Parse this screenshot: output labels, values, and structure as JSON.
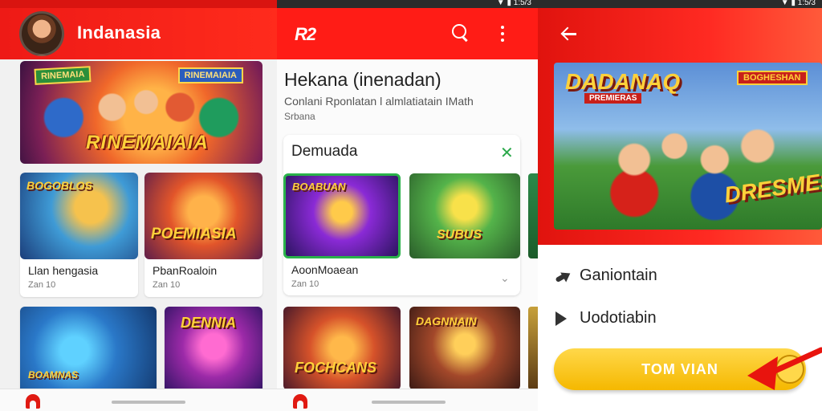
{
  "panel1": {
    "app_name": "Indanasia",
    "hero": {
      "title": "RINEMAIAIA",
      "tag_left": "RINEMAIA",
      "tag_right": "RINEMAIAIA"
    },
    "cards": [
      {
        "thumb_label": "BOGOBLOS",
        "title": "Llan hengasia",
        "sub": "Zan 10"
      },
      {
        "thumb_label": "POEMIASIA",
        "title": "PbanRoaloin",
        "sub": "Zan 10"
      }
    ],
    "tiles": [
      {
        "label": "BOAMNAS"
      },
      {
        "label": "DENNIA"
      }
    ],
    "nav_icon": "home-icon"
  },
  "panel2": {
    "status_text": "▼ ▮ 1:5/3",
    "logo": "R2",
    "heading": "Hekana (inenadan)",
    "sub1": "Conlani Rponlatan l almlatiatain IMath",
    "sub2": "Srbana",
    "section_title": "Demuada",
    "close_glyph": "✕",
    "card": {
      "title": "AoonMoaean",
      "sub": "Zan 10"
    },
    "tile_labels": [
      "BOABUAN",
      "SUBUS",
      "FOCHCANS",
      "DAGNNAIN"
    ]
  },
  "panel3": {
    "status_text": "▼ ▮ 1:5/3",
    "banner_title": "DADANAQ",
    "banner_sub": "PREMIERAS",
    "banner_tag": "BOGHESHAN",
    "banner_games": "DRESMES",
    "menu": [
      {
        "icon": "share-arrow-icon",
        "label": "Ganiontain"
      },
      {
        "icon": "play-icon",
        "label": "Uodotiabin"
      }
    ],
    "cta_label": "TOM VIAN"
  },
  "colors": {
    "brand_red": "#ff1c16",
    "cta_yellow": "#ffd84a",
    "accent_green": "#2ab24a"
  }
}
